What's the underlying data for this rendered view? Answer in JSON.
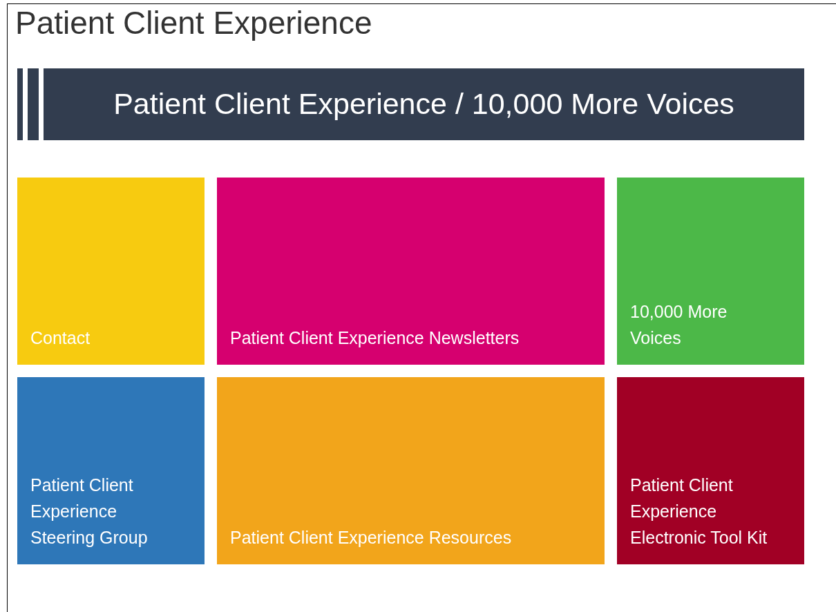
{
  "page_title": "Patient Client Experience",
  "banner": {
    "title": "Patient Client Experience / 10,000 More Voices"
  },
  "tiles": [
    {
      "label": "Contact",
      "color": "#f7cb10"
    },
    {
      "label": "Patient Client Experience Newsletters",
      "color": "#d6006f"
    },
    {
      "label": "10,000 More Voices",
      "color": "#4cb848"
    },
    {
      "label": "Patient Client Experience Steering Group",
      "color": "#2e77b8"
    },
    {
      "label": "Patient Client Experience Resources",
      "color": "#f2a51b"
    },
    {
      "label": "Patient Client Experience Electronic Tool Kit",
      "color": "#a10025"
    }
  ]
}
